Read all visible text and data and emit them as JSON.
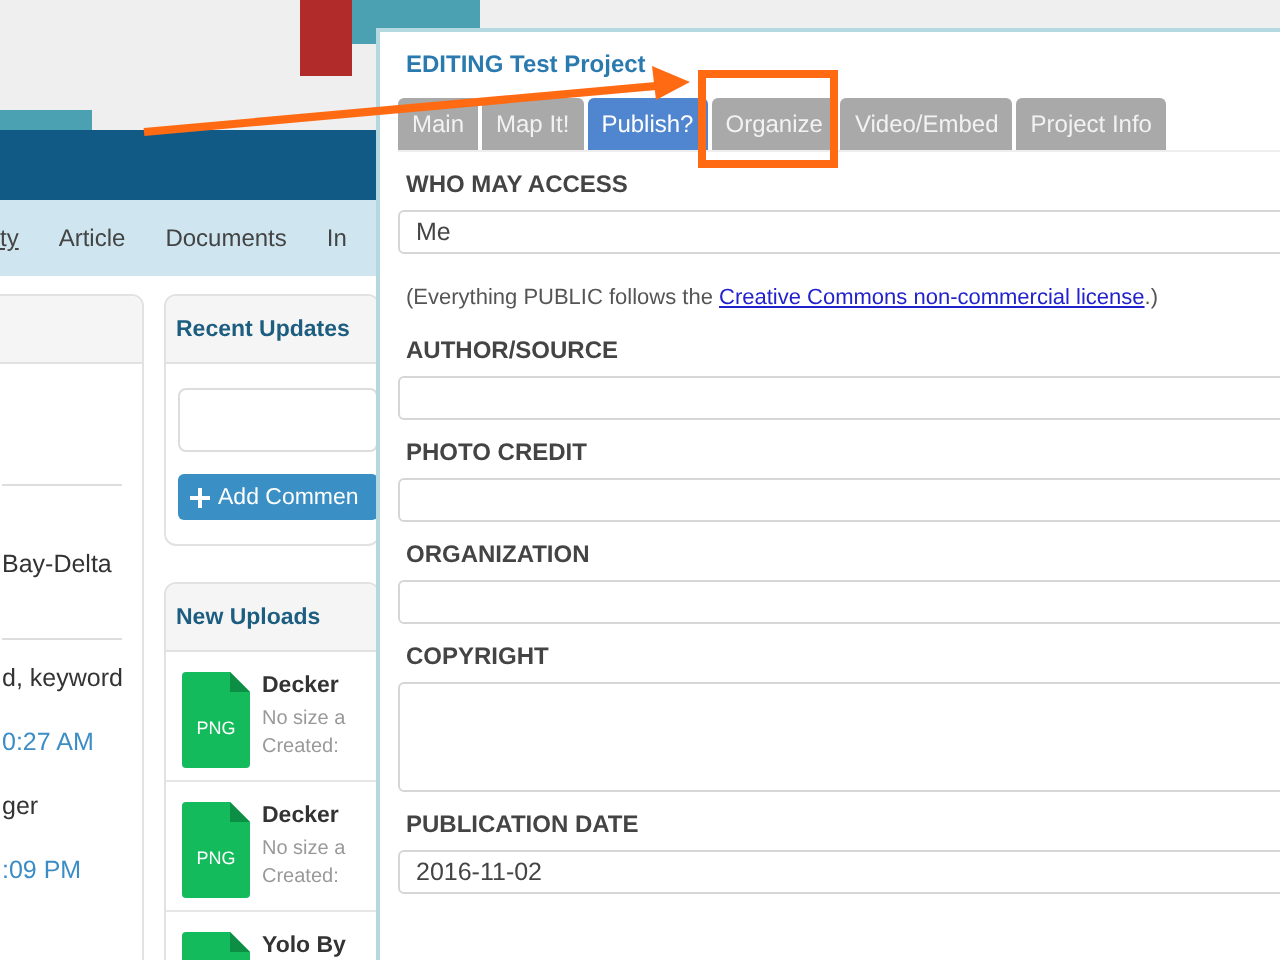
{
  "nav": {
    "items": [
      {
        "label": "ty",
        "selected": true
      },
      {
        "label": "Article",
        "selected": false
      },
      {
        "label": "Documents",
        "selected": false
      },
      {
        "label": "In",
        "selected": false
      }
    ]
  },
  "left_panel": {
    "lines": [
      {
        "kind": "text",
        "text": "Bay-Delta"
      },
      {
        "kind": "text",
        "text": "d, keyword"
      },
      {
        "kind": "time",
        "text": "0:27 AM"
      },
      {
        "kind": "name",
        "text": "ger"
      },
      {
        "kind": "time",
        "text": ":09 PM"
      }
    ]
  },
  "recent_updates": {
    "title": "Recent Updates",
    "button": "Add Commen"
  },
  "new_uploads": {
    "title": "New Uploads",
    "items": [
      {
        "file_type": "PNG",
        "name": "Decker",
        "size": "No size a",
        "created": "Created:"
      },
      {
        "file_type": "PNG",
        "name": "Decker",
        "size": "No size a",
        "created": "Created:"
      },
      {
        "name": "Yolo By"
      }
    ]
  },
  "editor": {
    "title": "EDITING Test Project",
    "tabs": [
      {
        "label": "Main",
        "selected": false
      },
      {
        "label": "Map It!",
        "selected": false
      },
      {
        "label": "Publish?",
        "selected": true
      },
      {
        "label": "Organize",
        "selected": false
      },
      {
        "label": "Video/Embed",
        "selected": false
      },
      {
        "label": "Project Info",
        "selected": false
      }
    ],
    "fields": [
      {
        "kind": "select",
        "label": "WHO MAY ACCESS",
        "value": "Me"
      },
      {
        "kind": "note",
        "before": "(Everything PUBLIC follows the ",
        "link": "Creative Commons non-commercial license",
        "after": ".)"
      },
      {
        "kind": "text",
        "label": "AUTHOR/SOURCE"
      },
      {
        "kind": "text",
        "label": "PHOTO CREDIT"
      },
      {
        "kind": "text",
        "label": "ORGANIZATION"
      },
      {
        "kind": "textarea",
        "label": "COPYRIGHT"
      },
      {
        "kind": "date",
        "label": "PUBLICATION DATE",
        "value": "2016-11-02"
      }
    ]
  }
}
